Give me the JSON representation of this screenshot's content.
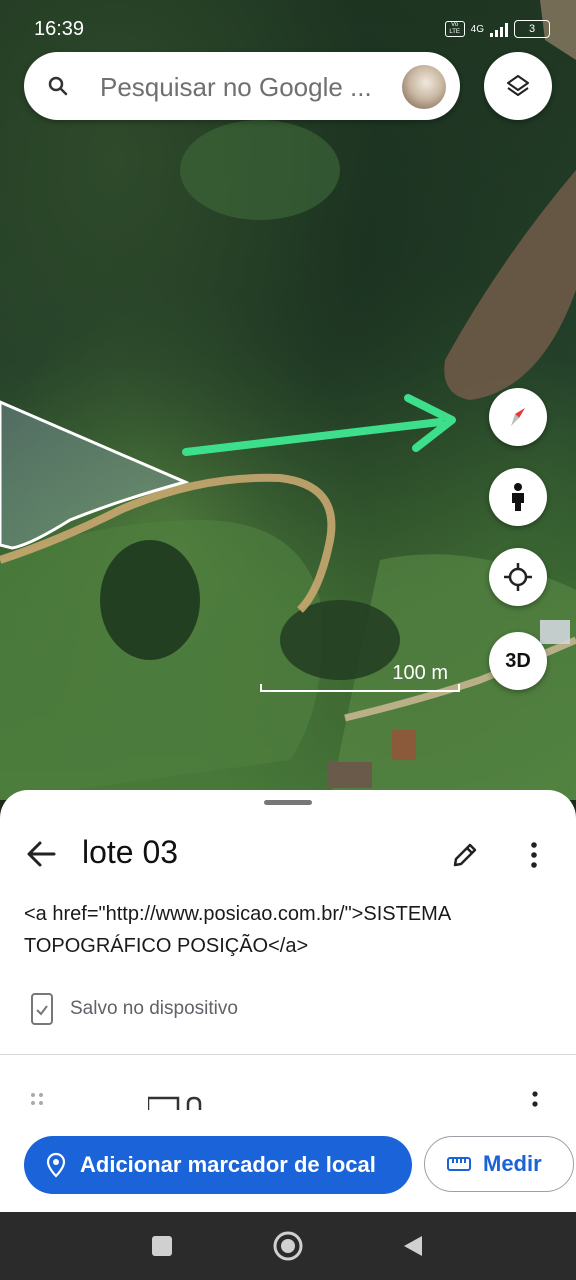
{
  "status_bar": {
    "time": "16:39",
    "volte": "Vo LTE",
    "network": "4G",
    "battery": "3"
  },
  "search": {
    "placeholder": "Pesquisar no Google ..."
  },
  "map": {
    "scale_label": "100 m"
  },
  "map_controls": {
    "button_3d": "3D"
  },
  "sheet": {
    "title": "lote 03",
    "description": "<a href=\"http://www.posicao.com.br/\">SISTEMA TOPOGRÁFICO POSIÇÃO</a>",
    "saved_status": "Salvo no dispositivo"
  },
  "actions": {
    "add_marker": "Adicionar marcador de local",
    "measure": "Medir"
  },
  "colors": {
    "accent": "#1a63d8",
    "arrow": "#3ddf8c"
  }
}
